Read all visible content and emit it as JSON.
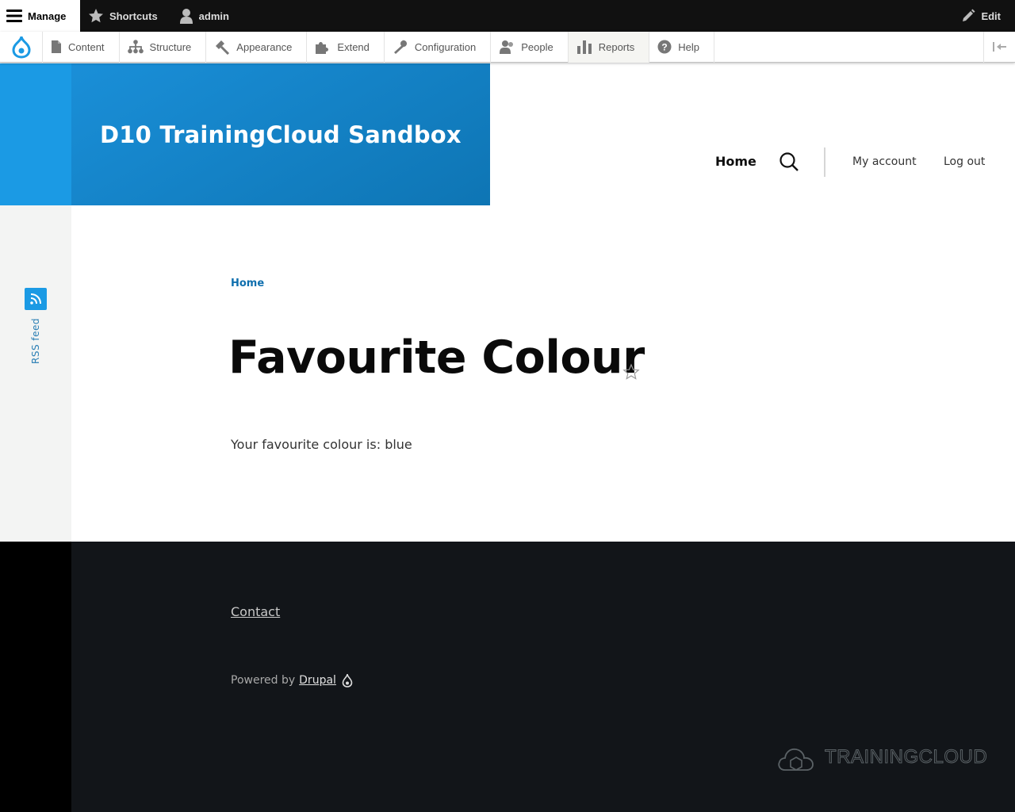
{
  "toolbar": {
    "manage_label": "Manage",
    "shortcuts_label": "Shortcuts",
    "user_label": "admin",
    "edit_label": "Edit"
  },
  "tray": {
    "items": [
      {
        "label": "Content",
        "icon": "file-icon"
      },
      {
        "label": "Structure",
        "icon": "sitemap-icon"
      },
      {
        "label": "Appearance",
        "icon": "paintbrush-icon"
      },
      {
        "label": "Extend",
        "icon": "puzzle-icon"
      },
      {
        "label": "Configuration",
        "icon": "wrench-icon"
      },
      {
        "label": "People",
        "icon": "people-icon"
      },
      {
        "label": "Reports",
        "icon": "bar-chart-icon"
      },
      {
        "label": "Help",
        "icon": "help-icon"
      }
    ]
  },
  "site": {
    "name": "D10 TrainingCloud Sandbox"
  },
  "nav": {
    "primary": "Home",
    "my_account": "My account",
    "log_out": "Log out"
  },
  "sidebar": {
    "rss_label": "RSS feed"
  },
  "main": {
    "breadcrumb": "Home",
    "title": "Favourite Colour",
    "body": "Your favourite colour is: blue"
  },
  "footer": {
    "contact": "Contact",
    "powered_by": "Powered by",
    "drupal": "Drupal",
    "logo_text": "TRAININGCLOUD"
  },
  "colors": {
    "brand_blue": "#1b9ae4",
    "link_blue": "#0f6fae",
    "footer_bg": "#121519"
  }
}
